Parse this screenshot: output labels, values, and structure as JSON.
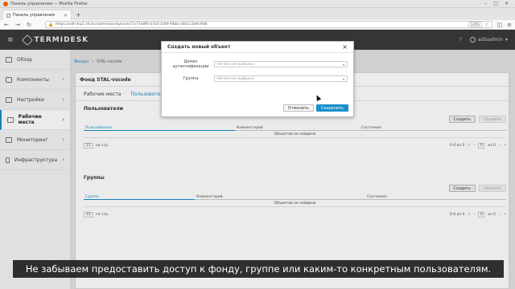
{
  "window": {
    "title": "Панель управления — Mozilla Firefox"
  },
  "browser": {
    "tab_label": "Панель управления",
    "url": "https://adt-dsp1.td.loc/admin/workplaces/7a77a8f6-47a5-5d0f-94bb-a0b1c1b9c9d8",
    "zoom": "120%"
  },
  "app": {
    "logo": "TERMIDESK",
    "user": "adisadmin"
  },
  "sidebar": {
    "items": [
      {
        "label": "Обзор"
      },
      {
        "label": "Компоненты"
      },
      {
        "label": "Настройки"
      },
      {
        "label": "Рабочие места"
      },
      {
        "label": "Мониторинг"
      },
      {
        "label": "Инфраструктура"
      }
    ]
  },
  "breadcrumb": {
    "root": "Фонды",
    "current": "STAL-vscode"
  },
  "card": {
    "title": "Фонд STAL-vscode",
    "tabs": [
      "Рабочие места",
      "Пользователи и группы"
    ]
  },
  "users": {
    "title": "Пользователи",
    "create": "Создать",
    "delete": "Удалить",
    "columns": [
      "Пользователь",
      "Комментарий",
      "Состояние"
    ],
    "empty": "Объектов не найдено",
    "per_page": "15",
    "per_page_label": "на стр.",
    "range": "0-0 из 0",
    "page": "0",
    "page_of": "из 0"
  },
  "groups": {
    "title": "Группы",
    "create": "Создать",
    "delete": "Удалить",
    "columns": [
      "Группа",
      "Комментарий",
      "Состояние"
    ],
    "empty": "Объектов не найдено",
    "per_page": "15",
    "per_page_label": "на стр.",
    "range": "0-0 из 0",
    "page": "0",
    "page_of": "из 0"
  },
  "modal": {
    "title": "Создать новый объект",
    "auth_domain_label": "Домен аутентификации",
    "auth_domain_value": "Ничего не выбрано",
    "group_label": "Группа",
    "group_value": "Ничего не выбрано",
    "cancel": "Отменить",
    "save": "Сохранить"
  },
  "subtitle": "Не забываем предоставить доступ к фонду, группе или каким-то конкретным пользователям.",
  "colors": {
    "accent": "#1a8ec9",
    "header_bg": "#3a3a3a"
  }
}
